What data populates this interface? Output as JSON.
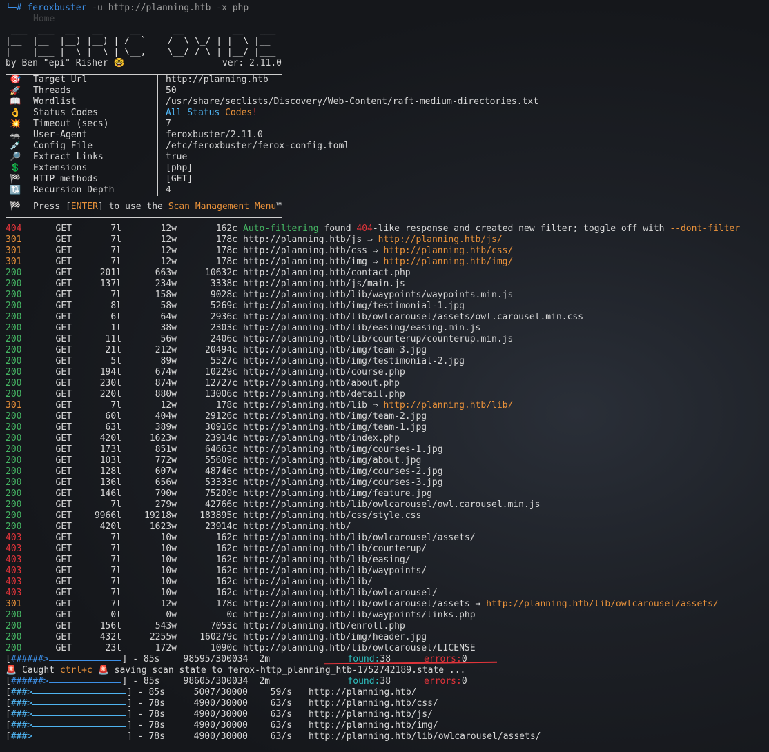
{
  "prompt": {
    "prefix": "└─#",
    "command": "feroxbuster",
    "args": "-u http://planning.htb -x php",
    "ghost": "Home"
  },
  "banner": {
    "art": [
      " ___  ___  __   __     __      __         __   ___",
      "|__  |__  |__) |__) | /  `    /  \\ \\_/ | |  \\ |__",
      "|    |___ |  \\ |  \\ | \\__,    \\__/ / \\ | |__/ |___"
    ],
    "author": "by Ben \"epi\" Risher 🤓",
    "version": "ver: 2.11.0"
  },
  "config": [
    {
      "icon": "🎯",
      "key": "Target Url",
      "value": "http://planning.htb"
    },
    {
      "icon": "🚀",
      "key": "Threads",
      "value": "50"
    },
    {
      "icon": "📖",
      "key": "Wordlist",
      "value": "/usr/share/seclists/Discovery/Web-Content/raft-medium-directories.txt"
    },
    {
      "icon": "👌",
      "key": "Status Codes",
      "value_parts": [
        "All Status",
        "Codes",
        "!"
      ]
    },
    {
      "icon": "💥",
      "key": "Timeout (secs)",
      "value": "7"
    },
    {
      "icon": "🦡",
      "key": "User-Agent",
      "value": "feroxbuster/2.11.0"
    },
    {
      "icon": "💉",
      "key": "Config File",
      "value": "/etc/feroxbuster/ferox-config.toml"
    },
    {
      "icon": "🔎",
      "key": "Extract Links",
      "value": "true"
    },
    {
      "icon": "💲",
      "key": "Extensions",
      "value": "[php]"
    },
    {
      "icon": "🏁",
      "key": "HTTP methods",
      "value": "[GET]"
    },
    {
      "icon": "🔃",
      "key": "Recursion Depth",
      "value": "4"
    }
  ],
  "press": {
    "icon": "🏁",
    "pre": "Press [",
    "key": "ENTER",
    "mid": "] to use the ",
    "link": "Scan Management Menu",
    "post": "™"
  },
  "results": [
    {
      "st": "404",
      "m": "GET",
      "l": "7l",
      "w": "12w",
      "c": "162c",
      "af": true
    },
    {
      "st": "301",
      "m": "GET",
      "l": "7l",
      "w": "12w",
      "c": "178c",
      "u": "http://planning.htb/js",
      "r": "http://planning.htb/js/"
    },
    {
      "st": "301",
      "m": "GET",
      "l": "7l",
      "w": "12w",
      "c": "178c",
      "u": "http://planning.htb/css",
      "r": "http://planning.htb/css/"
    },
    {
      "st": "301",
      "m": "GET",
      "l": "7l",
      "w": "12w",
      "c": "178c",
      "u": "http://planning.htb/img",
      "r": "http://planning.htb/img/"
    },
    {
      "st": "200",
      "m": "GET",
      "l": "201l",
      "w": "663w",
      "c": "10632c",
      "u": "http://planning.htb/contact.php"
    },
    {
      "st": "200",
      "m": "GET",
      "l": "137l",
      "w": "234w",
      "c": "3338c",
      "u": "http://planning.htb/js/main.js"
    },
    {
      "st": "200",
      "m": "GET",
      "l": "7l",
      "w": "158w",
      "c": "9028c",
      "u": "http://planning.htb/lib/waypoints/waypoints.min.js"
    },
    {
      "st": "200",
      "m": "GET",
      "l": "8l",
      "w": "58w",
      "c": "5269c",
      "u": "http://planning.htb/img/testimonial-1.jpg"
    },
    {
      "st": "200",
      "m": "GET",
      "l": "6l",
      "w": "64w",
      "c": "2936c",
      "u": "http://planning.htb/lib/owlcarousel/assets/owl.carousel.min.css"
    },
    {
      "st": "200",
      "m": "GET",
      "l": "1l",
      "w": "38w",
      "c": "2303c",
      "u": "http://planning.htb/lib/easing/easing.min.js"
    },
    {
      "st": "200",
      "m": "GET",
      "l": "11l",
      "w": "56w",
      "c": "2406c",
      "u": "http://planning.htb/lib/counterup/counterup.min.js"
    },
    {
      "st": "200",
      "m": "GET",
      "l": "21l",
      "w": "212w",
      "c": "20494c",
      "u": "http://planning.htb/img/team-3.jpg"
    },
    {
      "st": "200",
      "m": "GET",
      "l": "5l",
      "w": "89w",
      "c": "5527c",
      "u": "http://planning.htb/img/testimonial-2.jpg"
    },
    {
      "st": "200",
      "m": "GET",
      "l": "194l",
      "w": "674w",
      "c": "10229c",
      "u": "http://planning.htb/course.php"
    },
    {
      "st": "200",
      "m": "GET",
      "l": "230l",
      "w": "874w",
      "c": "12727c",
      "u": "http://planning.htb/about.php"
    },
    {
      "st": "200",
      "m": "GET",
      "l": "220l",
      "w": "880w",
      "c": "13006c",
      "u": "http://planning.htb/detail.php"
    },
    {
      "st": "301",
      "m": "GET",
      "l": "7l",
      "w": "12w",
      "c": "178c",
      "u": "http://planning.htb/lib",
      "r": "http://planning.htb/lib/"
    },
    {
      "st": "200",
      "m": "GET",
      "l": "60l",
      "w": "404w",
      "c": "29126c",
      "u": "http://planning.htb/img/team-2.jpg"
    },
    {
      "st": "200",
      "m": "GET",
      "l": "63l",
      "w": "389w",
      "c": "30916c",
      "u": "http://planning.htb/img/team-1.jpg"
    },
    {
      "st": "200",
      "m": "GET",
      "l": "420l",
      "w": "1623w",
      "c": "23914c",
      "u": "http://planning.htb/index.php"
    },
    {
      "st": "200",
      "m": "GET",
      "l": "173l",
      "w": "851w",
      "c": "64663c",
      "u": "http://planning.htb/img/courses-1.jpg"
    },
    {
      "st": "200",
      "m": "GET",
      "l": "103l",
      "w": "772w",
      "c": "55609c",
      "u": "http://planning.htb/img/about.jpg"
    },
    {
      "st": "200",
      "m": "GET",
      "l": "128l",
      "w": "607w",
      "c": "48746c",
      "u": "http://planning.htb/img/courses-2.jpg"
    },
    {
      "st": "200",
      "m": "GET",
      "l": "136l",
      "w": "656w",
      "c": "53333c",
      "u": "http://planning.htb/img/courses-3.jpg"
    },
    {
      "st": "200",
      "m": "GET",
      "l": "146l",
      "w": "790w",
      "c": "75209c",
      "u": "http://planning.htb/img/feature.jpg"
    },
    {
      "st": "200",
      "m": "GET",
      "l": "7l",
      "w": "279w",
      "c": "42766c",
      "u": "http://planning.htb/lib/owlcarousel/owl.carousel.min.js"
    },
    {
      "st": "200",
      "m": "GET",
      "l": "9966l",
      "w": "19218w",
      "c": "183895c",
      "u": "http://planning.htb/css/style.css"
    },
    {
      "st": "200",
      "m": "GET",
      "l": "420l",
      "w": "1623w",
      "c": "23914c",
      "u": "http://planning.htb/"
    },
    {
      "st": "403",
      "m": "GET",
      "l": "7l",
      "w": "10w",
      "c": "162c",
      "u": "http://planning.htb/lib/owlcarousel/assets/"
    },
    {
      "st": "403",
      "m": "GET",
      "l": "7l",
      "w": "10w",
      "c": "162c",
      "u": "http://planning.htb/lib/counterup/"
    },
    {
      "st": "403",
      "m": "GET",
      "l": "7l",
      "w": "10w",
      "c": "162c",
      "u": "http://planning.htb/lib/easing/"
    },
    {
      "st": "403",
      "m": "GET",
      "l": "7l",
      "w": "10w",
      "c": "162c",
      "u": "http://planning.htb/lib/waypoints/"
    },
    {
      "st": "403",
      "m": "GET",
      "l": "7l",
      "w": "10w",
      "c": "162c",
      "u": "http://planning.htb/lib/"
    },
    {
      "st": "403",
      "m": "GET",
      "l": "7l",
      "w": "10w",
      "c": "162c",
      "u": "http://planning.htb/lib/owlcarousel/"
    },
    {
      "st": "301",
      "m": "GET",
      "l": "7l",
      "w": "12w",
      "c": "178c",
      "u": "http://planning.htb/lib/owlcarousel/assets",
      "r": "http://planning.htb/lib/owlcarousel/assets/"
    },
    {
      "st": "200",
      "m": "GET",
      "l": "0l",
      "w": "0w",
      "c": "0c",
      "u": "http://planning.htb/lib/waypoints/links.php"
    },
    {
      "st": "200",
      "m": "GET",
      "l": "156l",
      "w": "543w",
      "c": "7053c",
      "u": "http://planning.htb/enroll.php"
    },
    {
      "st": "200",
      "m": "GET",
      "l": "432l",
      "w": "2255w",
      "c": "160279c",
      "u": "http://planning.htb/img/header.jpg"
    },
    {
      "st": "200",
      "m": "GET",
      "l": "23l",
      "w": "172w",
      "c": "1090c",
      "u": "http://planning.htb/lib/owlcarousel/LICENSE"
    }
  ],
  "autofilter": {
    "a": "Auto-filtering",
    "b": " found ",
    "c": "404",
    "d": "-like response and created new filter; toggle off with ",
    "e": "--dont-filter"
  },
  "arrow": " ⇒ ",
  "summary1": {
    "bar": "######>",
    "t": "- 85s",
    "n": "98595/300034",
    "tm": "2m",
    "found_label": "found:",
    "found": "38",
    "err_label": "errors:",
    "err": "0"
  },
  "caught": {
    "a": "🚨 Caught ",
    "b": "ctrl+c",
    "c": " 🚨 saving scan state to ferox-http_planning_htb-1752742189.state ..."
  },
  "summary2": {
    "bar": "######>",
    "t": "- 85s",
    "n": "98605/300034",
    "tm": "2m",
    "found_label": "found:",
    "found": "38",
    "err_label": "errors:",
    "err": "0"
  },
  "progress": [
    {
      "bar": "###>",
      "t": "- 85s",
      "n": "5007/30000",
      "r": "59/s",
      "u": "http://planning.htb/"
    },
    {
      "bar": "###>",
      "t": "- 78s",
      "n": "4900/30000",
      "r": "63/s",
      "u": "http://planning.htb/css/"
    },
    {
      "bar": "###>",
      "t": "- 78s",
      "n": "4900/30000",
      "r": "63/s",
      "u": "http://planning.htb/js/"
    },
    {
      "bar": "###>",
      "t": "- 78s",
      "n": "4900/30000",
      "r": "63/s",
      "u": "http://planning.htb/img/"
    },
    {
      "bar": "###>",
      "t": "- 78s",
      "n": "4900/30000",
      "r": "63/s",
      "u": "http://planning.htb/lib/owlcarousel/assets/"
    }
  ],
  "colors": {
    "ok": "#45b563",
    "redir": "#e8913a",
    "forbidden": "#e0343a",
    "notfound": "#e0343a",
    "link": "#e8913a"
  }
}
